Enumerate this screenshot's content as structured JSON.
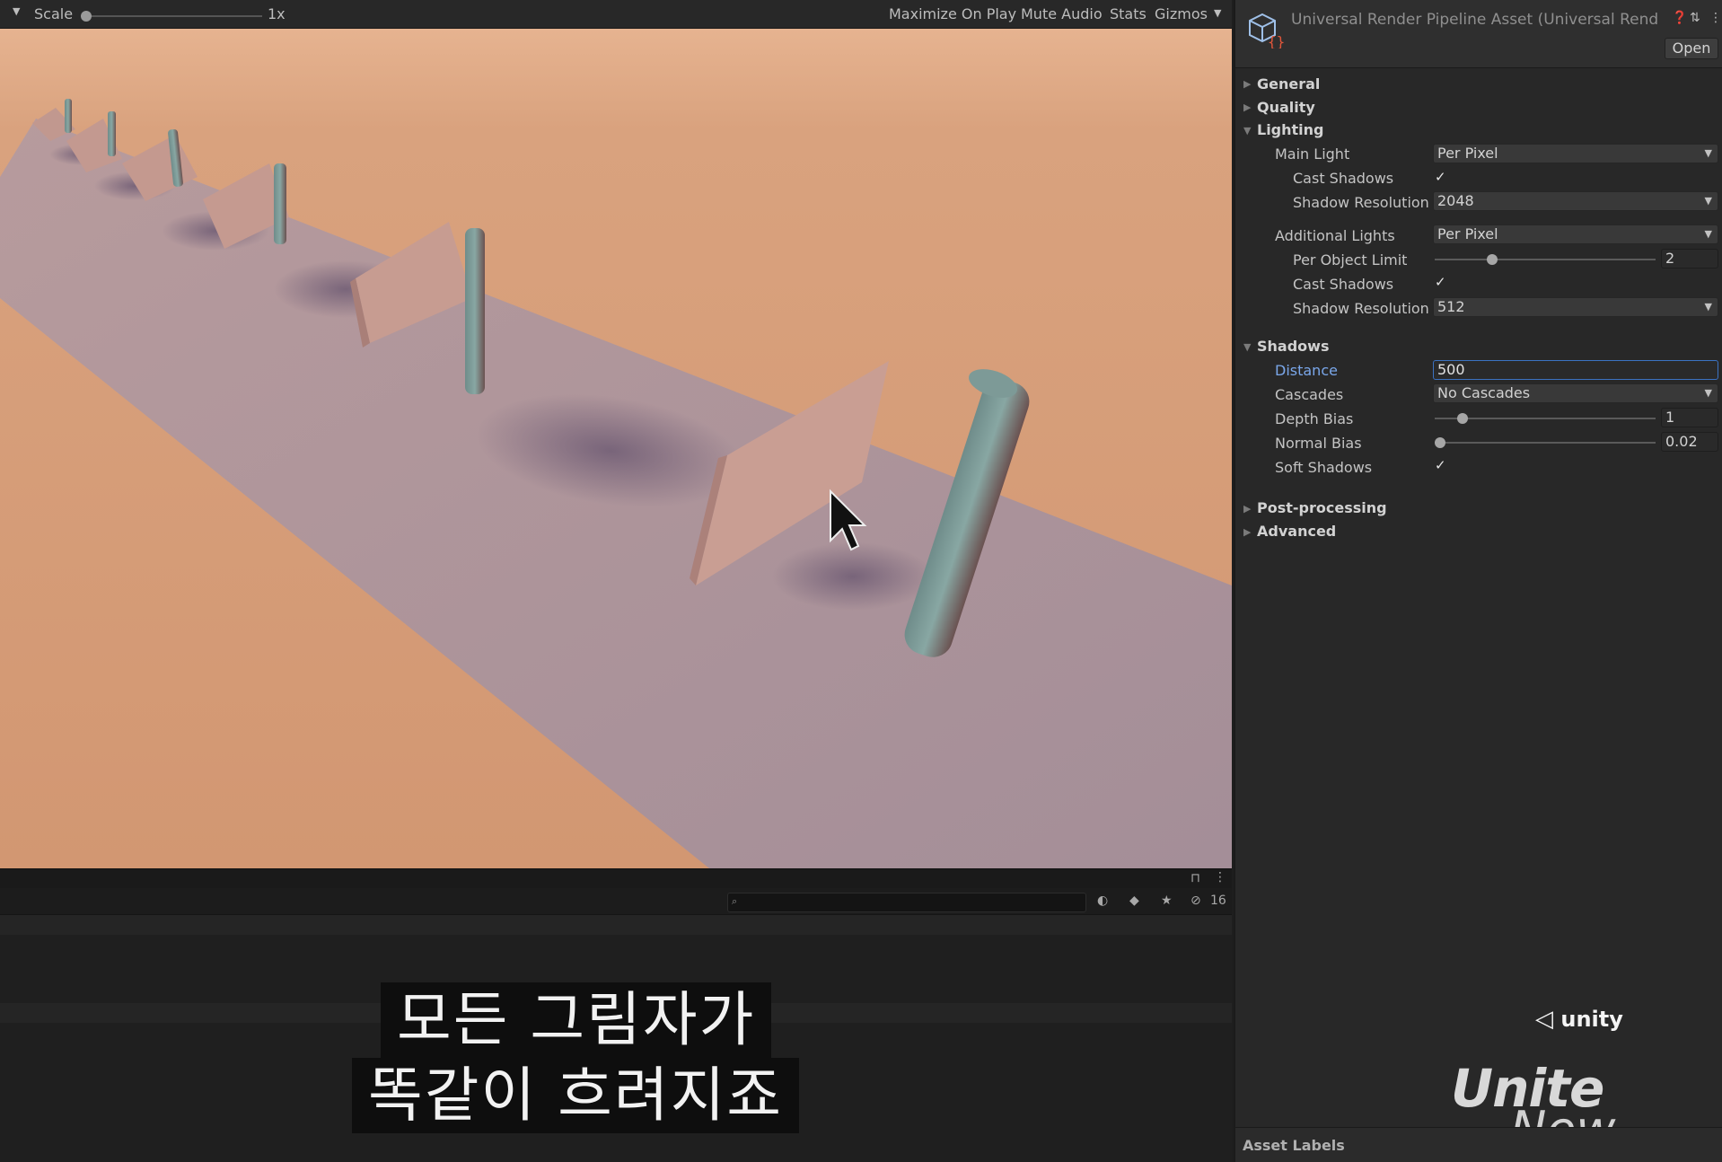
{
  "toolbar": {
    "scale_label": "Scale",
    "scale_value": "1x",
    "scale_level": 0.0,
    "maximize_on_play": "Maximize On Play",
    "mute_audio": "Mute Audio",
    "stats": "Stats",
    "gizmos": "Gizmos"
  },
  "bottom": {
    "hidden_count": "16"
  },
  "subtitle": {
    "line1": "모든 그림자가",
    "line2": "똑같이 흐려지죠"
  },
  "inspector": {
    "asset_title": "Universal Render Pipeline Asset (Universal Rende",
    "open_button": "Open",
    "sections": {
      "general": "General",
      "quality": "Quality",
      "lighting": "Lighting",
      "shadows": "Shadows",
      "post_processing": "Post-processing",
      "advanced": "Advanced"
    },
    "lighting": {
      "main_light_label": "Main Light",
      "main_light_value": "Per Pixel",
      "main_cast_shadows_label": "Cast Shadows",
      "main_cast_shadows": true,
      "main_shadow_res_label": "Shadow Resolution",
      "main_shadow_res_value": "2048",
      "additional_lights_label": "Additional Lights",
      "additional_lights_value": "Per Pixel",
      "per_object_limit_label": "Per Object Limit",
      "per_object_limit_value": "2",
      "add_cast_shadows_label": "Cast Shadows",
      "add_cast_shadows": true,
      "add_shadow_res_label": "Shadow Resolution",
      "add_shadow_res_value": "512"
    },
    "shadows": {
      "distance_label": "Distance",
      "distance_value": "500",
      "cascades_label": "Cascades",
      "cascades_value": "No Cascades",
      "depth_bias_label": "Depth Bias",
      "depth_bias_value": "1",
      "normal_bias_label": "Normal Bias",
      "normal_bias_value": "0.02",
      "soft_shadows_label": "Soft Shadows",
      "soft_shadows": true
    },
    "asset_labels": "Asset Labels"
  },
  "branding": {
    "unity": "unity",
    "unite": "Unite",
    "now": "Now"
  },
  "colors": {
    "accent_blue": "#3b72c2",
    "active_label_blue": "#7aa7ea",
    "sky_orange": "#d59c78",
    "ground_purple": "#a58f99"
  }
}
